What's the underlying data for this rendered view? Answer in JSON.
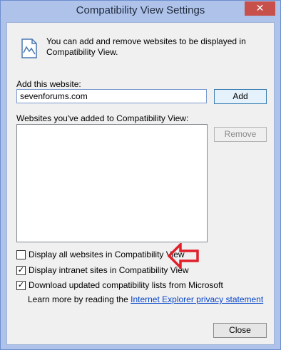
{
  "window": {
    "title": "Compatibility View Settings",
    "close_glyph": "✕"
  },
  "info": {
    "icon": "compat-view-icon",
    "text": "You can add and remove websites to be displayed in Compatibility View."
  },
  "add": {
    "label": "Add this website:",
    "input_value": "sevenforums.com",
    "button": "Add"
  },
  "list": {
    "label": "Websites you've added to Compatibility View:",
    "items": [],
    "remove_button": "Remove"
  },
  "options": [
    {
      "label": "Display all websites in Compatibility View",
      "checked": false
    },
    {
      "label": "Display intranet sites in Compatibility View",
      "checked": true
    },
    {
      "label": "Download updated compatibility lists from Microsoft",
      "checked": true
    }
  ],
  "learn_more": {
    "prefix": "Learn more by reading the",
    "link": "Internet Explorer privacy statement"
  },
  "close_button": "Close",
  "annotation": {
    "icon": "red-arrow-icon",
    "color": "#e0202a"
  }
}
